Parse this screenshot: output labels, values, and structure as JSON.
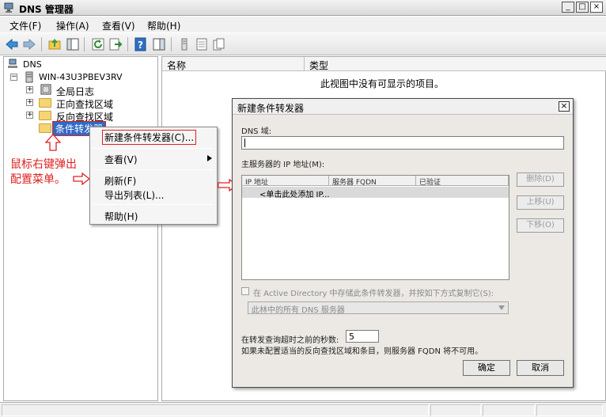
{
  "window": {
    "title": "DNS 管理器",
    "controls": [
      "_",
      "□",
      "×"
    ]
  },
  "menu": [
    "文件(F)",
    "操作(A)",
    "查看(V)",
    "帮助(H)"
  ],
  "toolbar": {
    "icons": [
      "back-arrow",
      "forward-arrow",
      "up-folder",
      "show-hide-tree",
      "refresh",
      "export-list",
      "help",
      "console-pane",
      "server-list",
      "properties",
      "copy"
    ]
  },
  "tree": {
    "root": "DNS",
    "server": "WIN-43U3PBEV3RV",
    "children": [
      "全局日志",
      "正向查找区域",
      "反向查找区域",
      "条件转发器"
    ]
  },
  "list": {
    "columns": [
      "名称",
      "类型"
    ],
    "empty_message": "此视图中没有可显示的项目。"
  },
  "context_menu": {
    "items": [
      "新建条件转发器(C)...",
      "查看(V)",
      "刷新(F)",
      "导出列表(L)...",
      "帮助(H)"
    ]
  },
  "annotation": {
    "line1": "鼠标右键弹出",
    "line2": "配置菜单。"
  },
  "dialog": {
    "title": "新建条件转发器",
    "close": "×",
    "dns_domain_label": "DNS 域:",
    "dns_domain_value": "",
    "master_servers_label": "主服务器的 IP 地址(M):",
    "grid_columns": [
      "IP 地址",
      "服务器 FQDN",
      "已验证"
    ],
    "grid_row": "<单击此处添加 IP...",
    "side_buttons": [
      "删除(D)",
      "上移(U)",
      "下移(O)"
    ],
    "ad_checkbox_label": "在 Active Directory 中存储此条件转发器，并按如下方式复制它(S):",
    "ad_dropdown": "此林中的所有 DNS 服务器",
    "timeout_label": "在转发查询超时之前的秒数:",
    "timeout_value": "5",
    "note": "如果未配置适当的反向查找区域和条目，则服务器 FQDN 将不可用。",
    "ok": "确定",
    "cancel": "取消"
  },
  "status": [
    "",
    "",
    "",
    ""
  ],
  "colors": {
    "annotation_red": "#e02020",
    "selection_blue": "#3169c6",
    "folder_yellow": "#f5d572"
  }
}
